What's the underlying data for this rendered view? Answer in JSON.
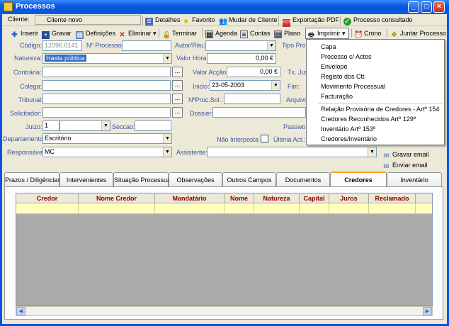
{
  "window": {
    "title": "Processos"
  },
  "toolbar1": {
    "cliente_label": "Cliente:",
    "cliente_value": "Cliente novo",
    "detalhes": "Detalhes",
    "favorito": "Favorito",
    "mudar_cliente": "Mudar de Cliente",
    "exportacao_pdf": "Exportação PDF",
    "processo_consultado": "Processo consultado"
  },
  "toolbar2": {
    "inserir": "Inserir",
    "gravar": "Gravar",
    "definicoes": "Definições",
    "eliminar": "Eliminar",
    "terminar": "Terminar",
    "agenda": "Agenda",
    "contas": "Contas",
    "plano": "Plano",
    "imprimir": "Imprimir",
    "crono": "Crono",
    "juntar_processo": "Juntar Processo"
  },
  "form": {
    "codigo_label": "Código:",
    "codigo_value": "12096.0141",
    "nprocesso_label": "Nº Processo:",
    "nprocesso_value": "",
    "autor_label": "Autor/Réu:",
    "tipo_proc_label": "Tipo Proc",
    "natureza_label": "Natureza:",
    "natureza_value": "Hasta pública",
    "valor_hora_label": "Valor Hora:",
    "valor_hora_value": "0,00 €",
    "contraria_label": "Contrária:",
    "valor_accao_label": "Valor Acção:",
    "valor_accao_value": "0,00 €",
    "tx_jus_label": "Tx. Jus",
    "colega_label": "Colega:",
    "inicio_label": "Inicio:",
    "inicio_value": "23-05-2003",
    "fim_label": "Fim:",
    "tribunal_label": "Tribunal:",
    "nproc_sol_label": "NºProc.Sol.:",
    "arquivo_label": "Arquivo",
    "solicitador_label": "Solicitador:",
    "dossier_label": "Dossier:",
    "juizo_label": "Juizo:",
    "juizo_value": "1",
    "seccao_label": "Seccao:",
    "password_label": "Passwor",
    "departamento_label": "Departamento:",
    "departamento_value": "Escritório",
    "nao_interposta_label": "Não Interposta",
    "ultima_act_label": "Última Act.:",
    "responsavel_label": "Responsável:",
    "responsavel_value": "MC",
    "assistente_label": "Assistente:",
    "gravar_email": "Gravar email",
    "enviar_email": "Enviar email"
  },
  "print_menu": {
    "items": [
      "Capa",
      "Processo c/ Actos",
      "Envelope",
      "Registo dos Ctt",
      "Movimento Processual",
      "Facturação"
    ],
    "items2": [
      "Relação Provisória de Credores - Artº 154",
      "Credores Reconhecidos Artº 129º",
      "Inventário Artº 153º",
      "Credores/Inventário"
    ]
  },
  "tabs": [
    "Prazos / Diligências",
    "Intervenientes",
    "Situação Processual",
    "Observações",
    "Outros Campos",
    "Documentos",
    "Credores",
    "Inventário"
  ],
  "active_tab": "Credores",
  "grid": {
    "columns": [
      "Credor",
      "Nome Credor",
      "Mandatário",
      "Nome",
      "Natureza",
      "Capital",
      "Juros",
      "Reclamado"
    ]
  },
  "colors": {
    "title_bar": "#0a5be4",
    "header_text": "#8b0000",
    "row_highlight": "#ffffc0",
    "label": "#3c55a5"
  }
}
